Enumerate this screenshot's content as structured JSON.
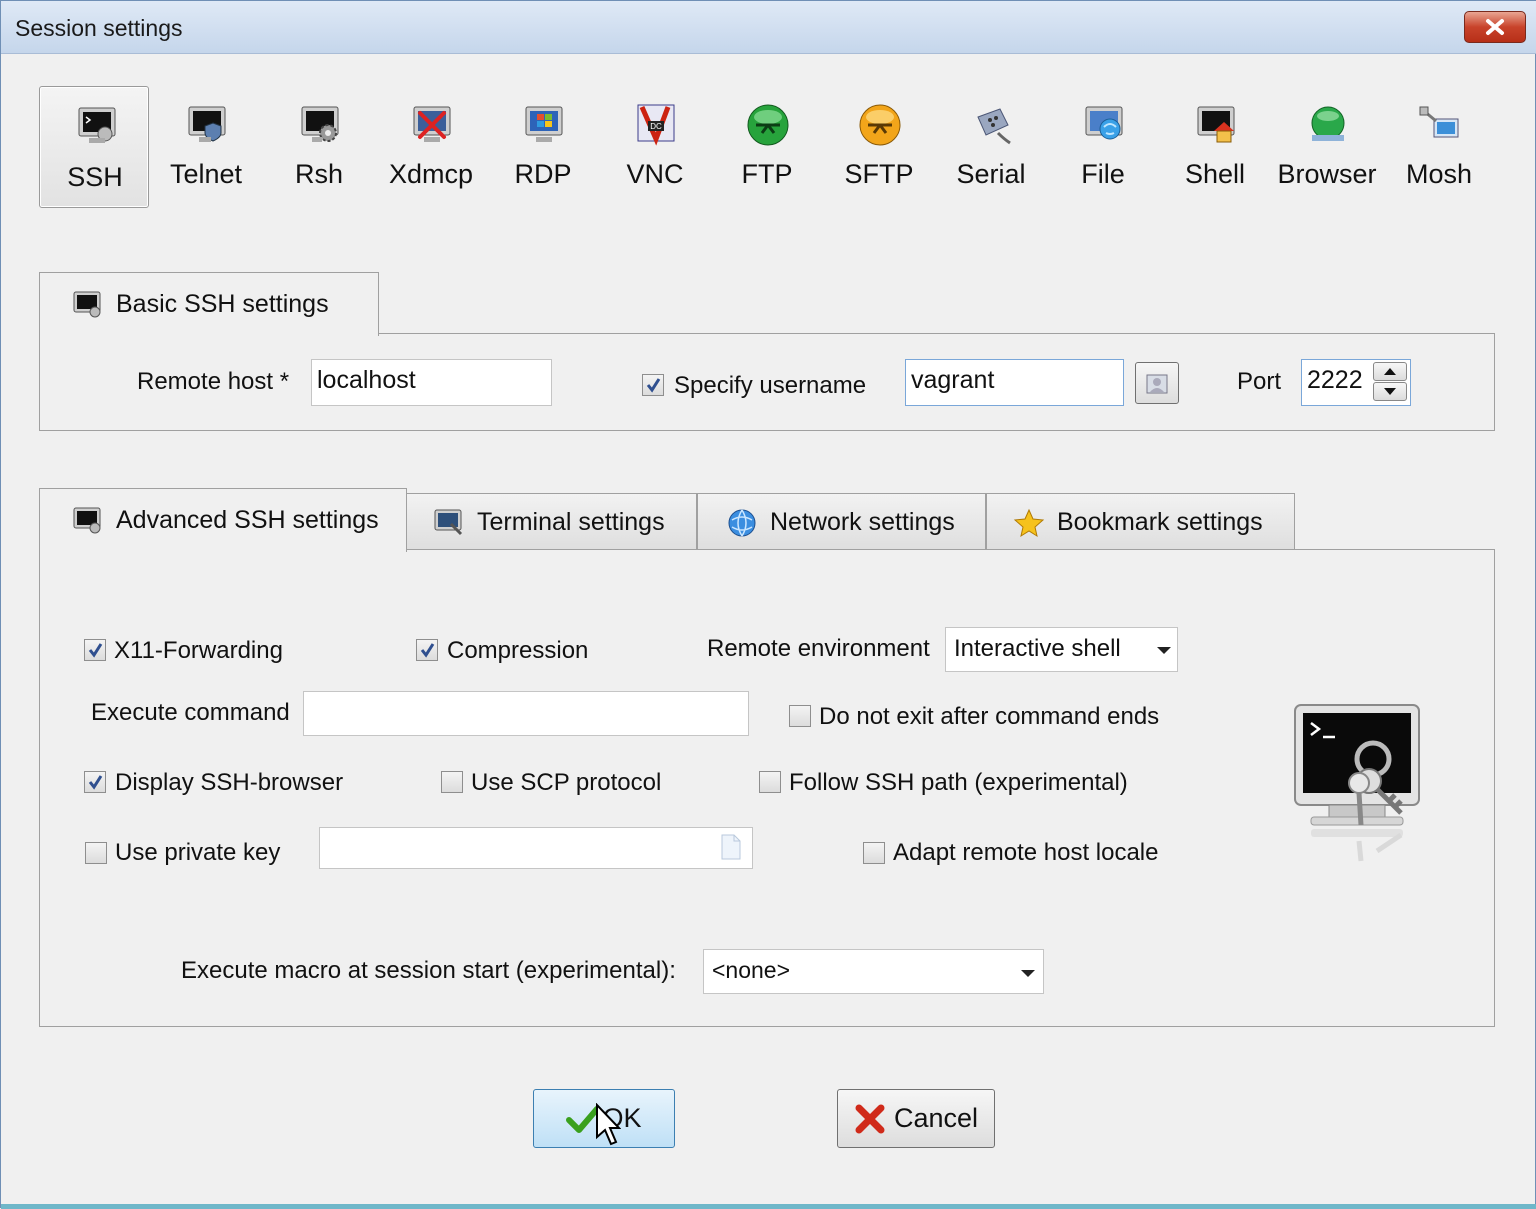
{
  "window": {
    "title": "Session settings"
  },
  "session_types": [
    {
      "label": "SSH",
      "icon": "ssh-terminal-icon",
      "selected": true
    },
    {
      "label": "Telnet",
      "icon": "telnet-shield-icon"
    },
    {
      "label": "Rsh",
      "icon": "rsh-gear-icon"
    },
    {
      "label": "Xdmcp",
      "icon": "xdmcp-icon"
    },
    {
      "label": "RDP",
      "icon": "rdp-windows-icon"
    },
    {
      "label": "VNC",
      "icon": "vnc-icon"
    },
    {
      "label": "FTP",
      "icon": "ftp-globe-icon"
    },
    {
      "label": "SFTP",
      "icon": "sftp-globe-icon"
    },
    {
      "label": "Serial",
      "icon": "serial-plug-icon"
    },
    {
      "label": "File",
      "icon": "file-globe-icon"
    },
    {
      "label": "Shell",
      "icon": "shell-house-icon"
    },
    {
      "label": "Browser",
      "icon": "browser-globe-icon"
    },
    {
      "label": "Mosh",
      "icon": "mosh-network-icon"
    }
  ],
  "basic": {
    "tab_label": "Basic SSH settings",
    "remote_host_label": "Remote host *",
    "remote_host_value": "localhost",
    "specify_username_label": "Specify username",
    "specify_username_checked": true,
    "username_value": "vagrant",
    "port_label": "Port",
    "port_value": "2222"
  },
  "tabs": [
    {
      "label": "Advanced SSH settings",
      "active": true
    },
    {
      "label": "Terminal settings"
    },
    {
      "label": "Network settings"
    },
    {
      "label": "Bookmark settings"
    }
  ],
  "advanced": {
    "x11_label": "X11-Forwarding",
    "x11_checked": true,
    "compression_label": "Compression",
    "compression_checked": true,
    "remote_env_label": "Remote environment",
    "remote_env_value": "Interactive shell",
    "exec_cmd_label": "Execute command",
    "exec_cmd_value": "",
    "no_exit_label": "Do not exit after command ends",
    "no_exit_checked": false,
    "ssh_browser_label": "Display SSH-browser",
    "ssh_browser_checked": true,
    "scp_label": "Use SCP protocol",
    "scp_checked": false,
    "follow_path_label": "Follow SSH path (experimental)",
    "follow_path_checked": false,
    "private_key_label": "Use private key",
    "private_key_checked": false,
    "private_key_value": "",
    "adapt_locale_label": "Adapt remote host locale",
    "adapt_locale_checked": false,
    "macro_label": "Execute macro at session start (experimental):",
    "macro_value": "<none>"
  },
  "buttons": {
    "ok": "OK",
    "cancel": "Cancel"
  },
  "colors": {
    "titlebar": "#c5d6eb",
    "close": "#c8432b",
    "ok_default": "#bfe0f6"
  }
}
